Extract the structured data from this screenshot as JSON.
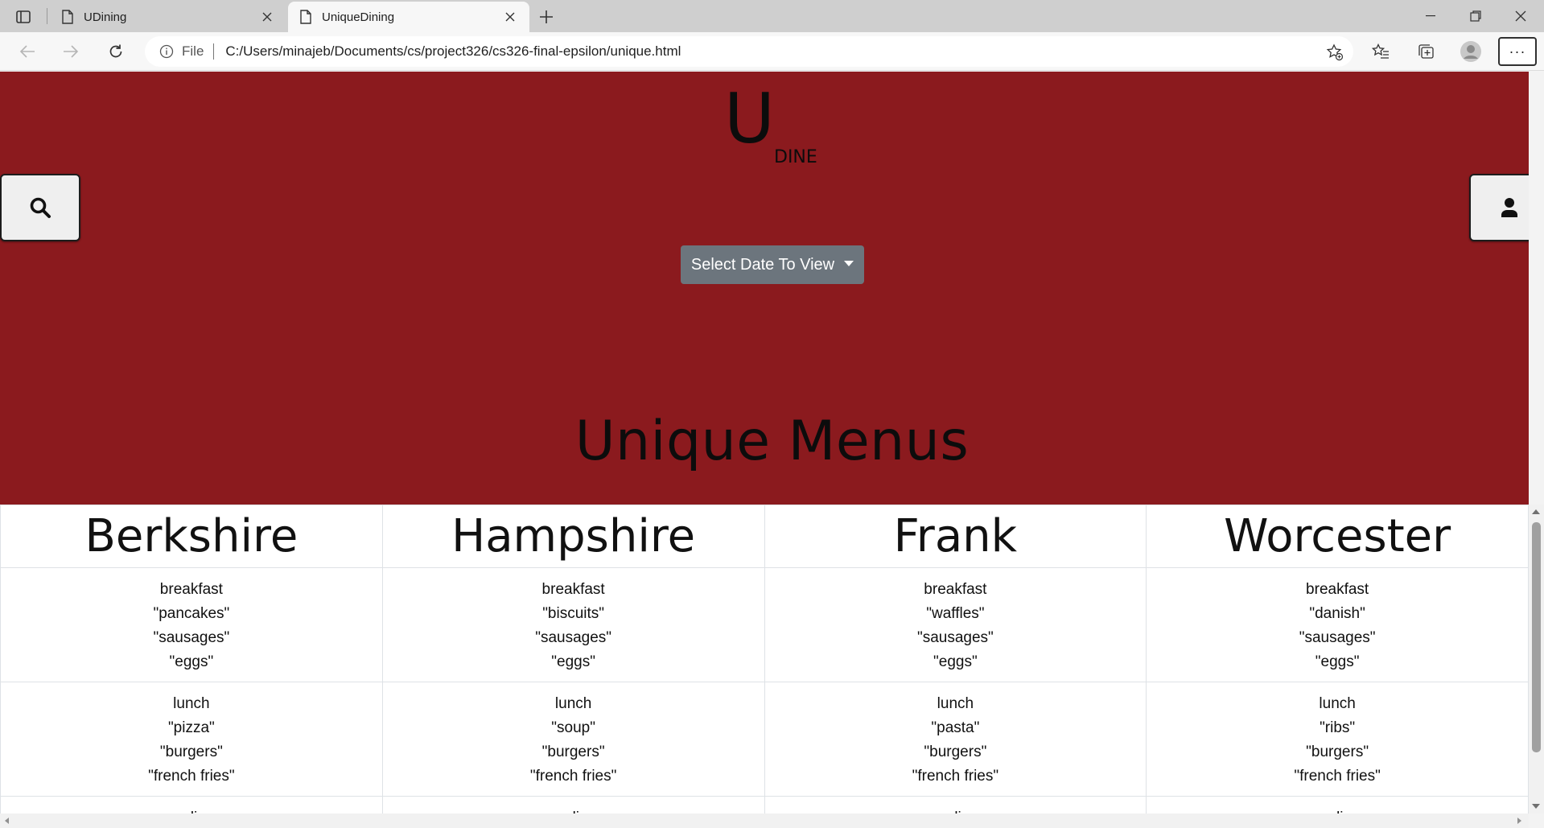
{
  "browser": {
    "tabs": [
      {
        "title": "UDining",
        "active": false
      },
      {
        "title": "UniqueDining",
        "active": true
      }
    ],
    "address": {
      "scheme_label": "File",
      "url": "C:/Users/minajeb/Documents/cs/project326/cs326-final-epsilon/unique.html"
    },
    "more_label": "···"
  },
  "page": {
    "background_color": "#8b1a1e",
    "logo": {
      "big": "U",
      "small": "DINE"
    },
    "date_dropdown": {
      "label": "Select Date To View"
    },
    "heading": "Unique Menus",
    "halls": [
      {
        "name": "Berkshire",
        "meals": [
          {
            "name": "breakfast",
            "items": [
              "\"pancakes\"",
              "\"sausages\"",
              "\"eggs\""
            ]
          },
          {
            "name": "lunch",
            "items": [
              "\"pizza\"",
              "\"burgers\"",
              "\"french fries\""
            ]
          }
        ]
      },
      {
        "name": "Hampshire",
        "meals": [
          {
            "name": "breakfast",
            "items": [
              "\"biscuits\"",
              "\"sausages\"",
              "\"eggs\""
            ]
          },
          {
            "name": "lunch",
            "items": [
              "\"soup\"",
              "\"burgers\"",
              "\"french fries\""
            ]
          }
        ]
      },
      {
        "name": "Frank",
        "meals": [
          {
            "name": "breakfast",
            "items": [
              "\"waffles\"",
              "\"sausages\"",
              "\"eggs\""
            ]
          },
          {
            "name": "lunch",
            "items": [
              "\"pasta\"",
              "\"burgers\"",
              "\"french fries\""
            ]
          }
        ]
      },
      {
        "name": "Worcester",
        "meals": [
          {
            "name": "breakfast",
            "items": [
              "\"danish\"",
              "\"sausages\"",
              "\"eggs\""
            ]
          },
          {
            "name": "lunch",
            "items": [
              "\"ribs\"",
              "\"burgers\"",
              "\"french fries\""
            ]
          }
        ]
      }
    ],
    "partial_row_text": [
      "di",
      "di",
      "di",
      "di"
    ]
  },
  "icons": {
    "search_button": "search-icon",
    "profile_button": "user-icon"
  }
}
